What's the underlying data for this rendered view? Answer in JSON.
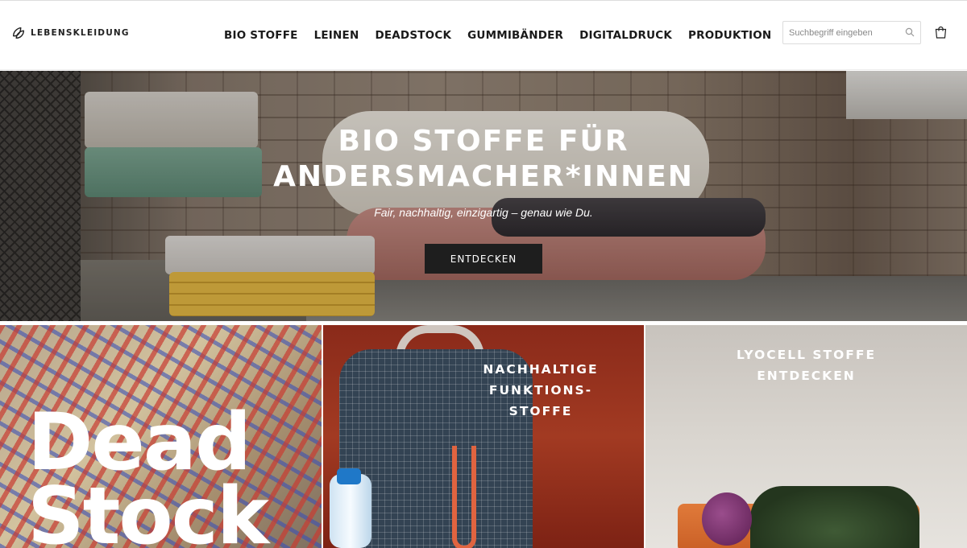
{
  "header": {
    "logo_text": "LEBENSKLEIDUNG",
    "nav": [
      "BIO STOFFE",
      "LEINEN",
      "DEADSTOCK",
      "GUMMIBÄNDER",
      "DIGITALDRUCK",
      "PRODUKTION"
    ],
    "search": {
      "placeholder": "Suchbegriff eingeben",
      "value": ""
    }
  },
  "hero": {
    "title_line1": "BIO STOFFE FÜR",
    "title_line2": "ANDERSMACHER*INNEN",
    "subtitle": "Fair, nachhaltig, einzigartig – genau wie Du.",
    "button": "ENTDECKEN"
  },
  "tiles": [
    {
      "big_line1": "Dead",
      "big_line2": "Stock"
    },
    {
      "label_line1": "NACHHALTIGE",
      "label_line2": "FUNKTIONS-",
      "label_line3": "STOFFE"
    },
    {
      "label_line1": "LYOCELL STOFFE",
      "label_line2": "ENTDECKEN"
    }
  ],
  "icons": {
    "logo": "leaf-logo-icon",
    "search": "search-icon",
    "cart": "shopping-bag-icon"
  },
  "colors": {
    "button_bg": "#1e1e1e",
    "text": "#1a1a1a"
  }
}
